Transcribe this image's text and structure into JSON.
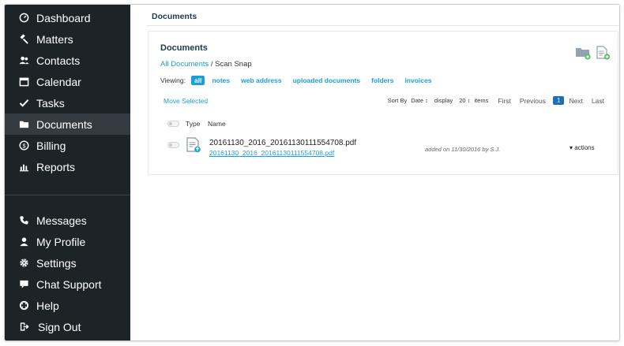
{
  "sidebar": {
    "top_items": [
      {
        "label": "Dashboard",
        "icon": "dashboard-icon"
      },
      {
        "label": "Matters",
        "icon": "gavel-icon"
      },
      {
        "label": "Contacts",
        "icon": "contacts-icon"
      },
      {
        "label": "Calendar",
        "icon": "calendar-icon"
      },
      {
        "label": "Tasks",
        "icon": "checkmark-icon"
      },
      {
        "label": "Documents",
        "icon": "folder-icon",
        "active": true
      },
      {
        "label": "Billing",
        "icon": "dollar-icon"
      },
      {
        "label": "Reports",
        "icon": "bar-chart-icon"
      }
    ],
    "bottom_items": [
      {
        "label": "Messages",
        "icon": "phone-icon"
      },
      {
        "label": "My Profile",
        "icon": "user-icon"
      },
      {
        "label": "Settings",
        "icon": "gear-icon"
      },
      {
        "label": "Chat Support",
        "icon": "chat-icon"
      },
      {
        "label": "Help",
        "icon": "help-icon"
      },
      {
        "label": "Sign Out",
        "icon": "sign-out-icon"
      }
    ]
  },
  "page": {
    "title": "Documents"
  },
  "panel": {
    "title": "Documents",
    "breadcrumb": {
      "root": "All Documents",
      "separator": "/",
      "current": "Scan Snap"
    },
    "viewing": {
      "label": "Viewing:",
      "filters": [
        "all",
        "notes",
        "web address",
        "uploaded documents",
        "folders",
        "invoices"
      ],
      "active": "all"
    },
    "toolbar": {
      "new_folder_icon": "add-folder-icon",
      "new_document_icon": "add-document-icon"
    },
    "move_selected": "Move Selected",
    "sort": {
      "label": "Sort By",
      "value": "Date ↕"
    },
    "display": {
      "label": "display",
      "value": "20 ↕",
      "suffix": "items"
    },
    "pagination": {
      "first": "First",
      "previous": "Previous",
      "current": "1",
      "next": "Next",
      "last": "Last"
    },
    "columns": {
      "type": "Type",
      "name": "Name"
    },
    "rows": [
      {
        "file_name": "20161130_2016_20161130111554708.pdf",
        "file_link": "20161130_2016_20161130111554708.pdf",
        "added": "added on 11/30/2016 by S.J.",
        "actions": "▾ actions"
      }
    ]
  },
  "colors": {
    "sidebar_bg": "#1d2428",
    "sidebar_active": "#353c41",
    "link": "#1a9fd6",
    "accent_green": "#5cb85c",
    "pagination_active": "#1f6fb3"
  }
}
